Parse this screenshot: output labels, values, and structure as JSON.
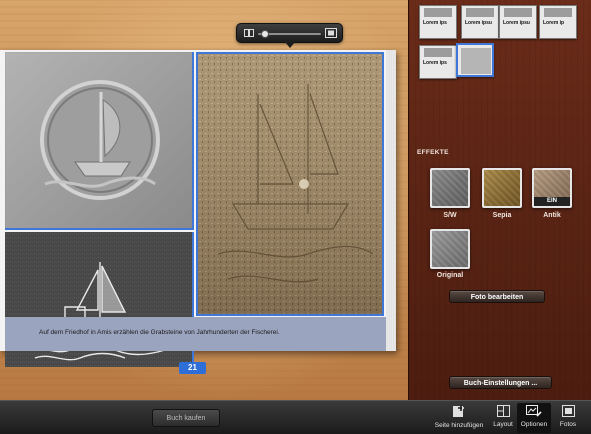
{
  "zoom": {
    "level": 0.05
  },
  "page": {
    "caption": "Auf dem Friedhof in Amis erzählen die Grabsteine von Jahrhunderten der Fischerei.",
    "number": "21"
  },
  "layouts": [
    {
      "label": "Lorem ips"
    },
    {
      "label": "Lorem ipsu"
    },
    {
      "label": "Lorem ipsu"
    },
    {
      "label": "Lorem ip"
    },
    {
      "label": "Lorem ips"
    },
    {
      "label": ""
    }
  ],
  "effects": {
    "title": "EFFEKTE",
    "items": [
      {
        "label": "S/W",
        "badge": ""
      },
      {
        "label": "Sepia",
        "badge": ""
      },
      {
        "label": "Antik",
        "badge": "EIN"
      },
      {
        "label": "Original",
        "badge": ""
      }
    ],
    "edit_button": "Foto bearbeiten"
  },
  "book_settings_button": "Buch-Einstellungen ...",
  "toolbar": {
    "buy_button": "Buch kaufen",
    "tools": [
      {
        "label": "Seite hinzufügen",
        "icon": "add-page-icon"
      },
      {
        "label": "Layout",
        "icon": "layout-icon"
      },
      {
        "label": "Optionen",
        "icon": "options-icon"
      },
      {
        "label": "Fotos",
        "icon": "photos-icon"
      }
    ]
  },
  "colors": {
    "selection": "#3f77d8",
    "page_number_bg": "#2e6ed8",
    "panel_wood": "#5a2414",
    "canvas_wood": "#c99057"
  }
}
